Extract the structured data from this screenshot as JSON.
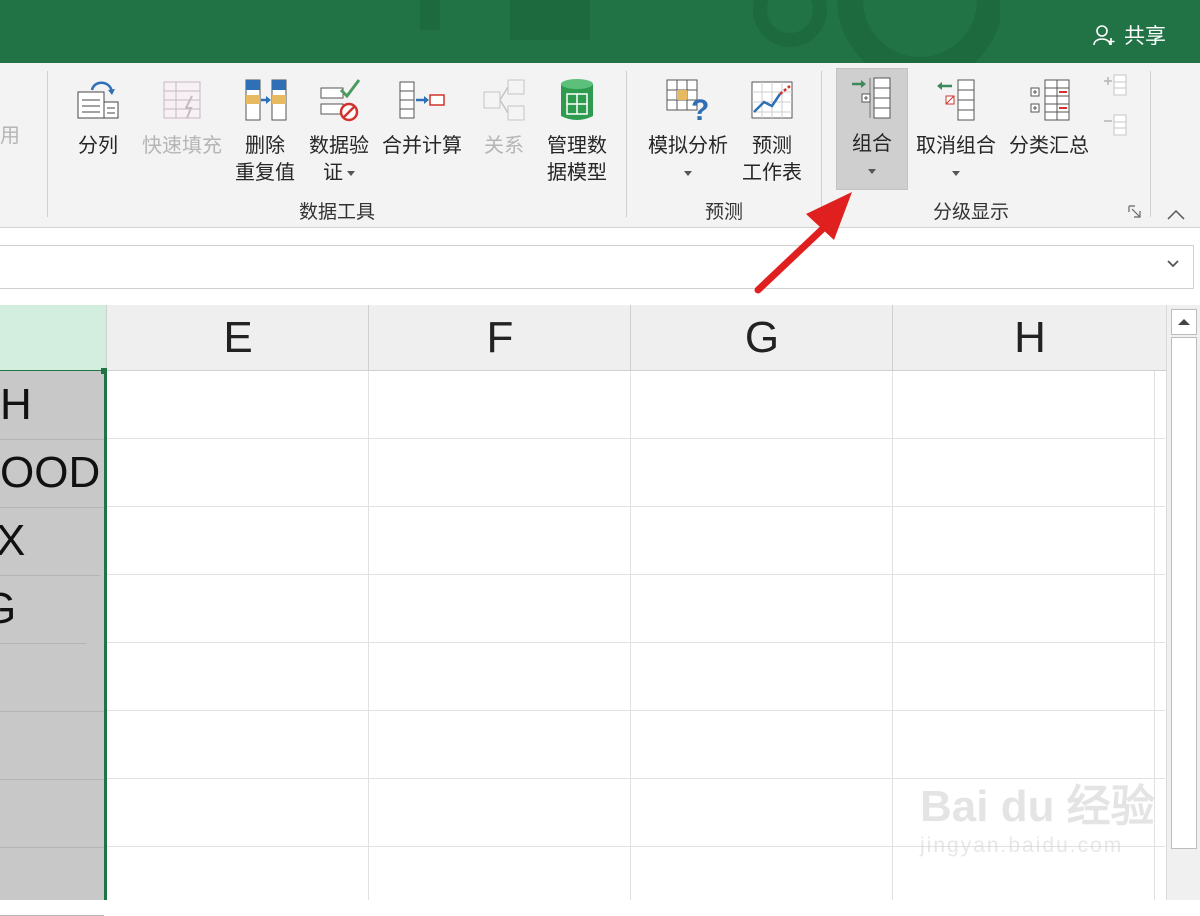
{
  "titlebar": {
    "share_label": "共享"
  },
  "ribbon": {
    "partial_label": "用",
    "groups": {
      "data_tools": "数据工具",
      "forecast": "预测",
      "outline": "分级显示"
    },
    "buttons": {
      "text_to_columns": "分列",
      "flash_fill": "快速填充",
      "remove_duplicates_1": "删除",
      "remove_duplicates_2": "重复值",
      "data_validation_1": "数据验",
      "data_validation_2": "证",
      "consolidate": "合并计算",
      "relationships": "关系",
      "data_model_1": "管理数",
      "data_model_2": "据模型",
      "what_if_1": "模拟分析",
      "forecast_sheet_1": "预测",
      "forecast_sheet_2": "工作表",
      "group": "组合",
      "ungroup": "取消组合",
      "subtotal": "分类汇总"
    }
  },
  "grid": {
    "columns": [
      "E",
      "F",
      "G",
      "H"
    ],
    "column_d_values": [
      "H",
      "OOD",
      "X",
      "G"
    ]
  },
  "watermark": {
    "brand": "Bai du 经验",
    "url": "jingyan.baidu.com"
  },
  "colors": {
    "excel_green": "#217346",
    "arrow_red": "#e0201f"
  }
}
